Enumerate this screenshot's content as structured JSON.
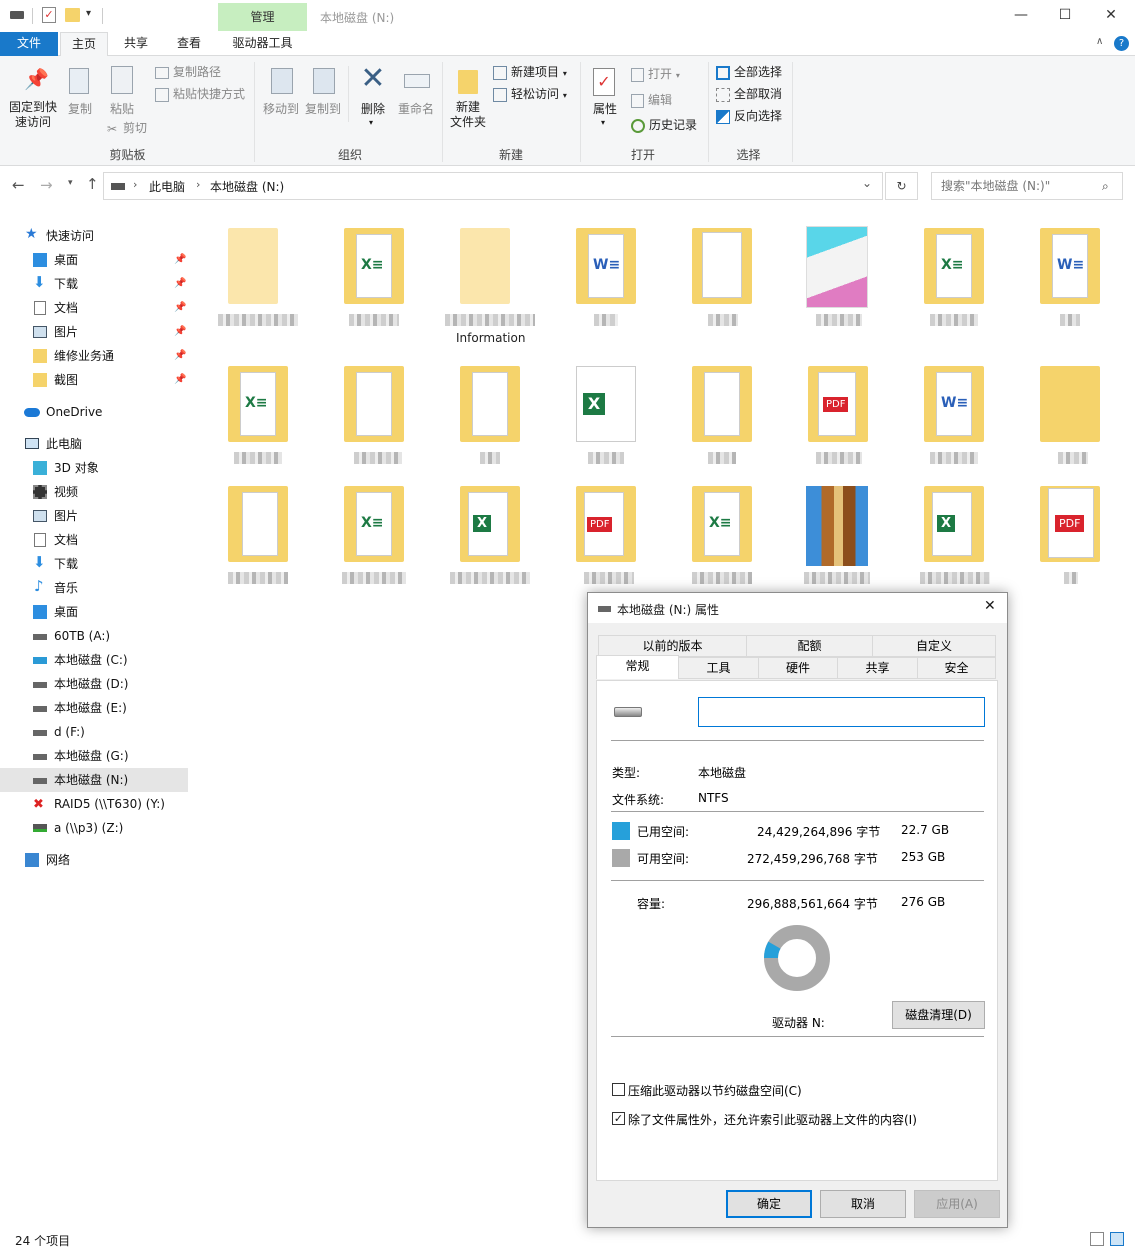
{
  "window": {
    "context_tab": "管理",
    "title": "本地磁盘 (N:)",
    "minimize": "—",
    "maximize": "☐",
    "close": "✕"
  },
  "ribbon_tabs": [
    {
      "label": "文件"
    },
    {
      "label": "主页"
    },
    {
      "label": "共享"
    },
    {
      "label": "查看"
    },
    {
      "label": "驱动器工具"
    }
  ],
  "ribbon": {
    "clipboard": {
      "pin": "固定到快\n速访问",
      "copy": "复制",
      "paste": "粘贴",
      "copy_path": "复制路径",
      "paste_shortcut": "粘贴快捷方式",
      "cut": "剪切",
      "label": "剪贴板"
    },
    "organize": {
      "move_to": "移动到",
      "copy_to": "复制到",
      "delete": "删除",
      "rename": "重命名",
      "label": "组织"
    },
    "new": {
      "new_folder": "新建\n文件夹",
      "new_item": "新建项目",
      "easy_access": "轻松访问",
      "label": "新建"
    },
    "open": {
      "properties": "属性",
      "open": "打开",
      "edit": "编辑",
      "history": "历史记录",
      "label": "打开"
    },
    "select": {
      "select_all": "全部选择",
      "select_none": "全部取消",
      "invert": "反向选择",
      "label": "选择"
    }
  },
  "address": {
    "crumb1": "此电脑",
    "crumb2": "本地磁盘 (N:)",
    "search_placeholder": "搜索\"本地磁盘 (N:)\""
  },
  "nav": {
    "quick_access": "快速访问",
    "quick_items": [
      {
        "label": "桌面"
      },
      {
        "label": "下载"
      },
      {
        "label": "文档"
      },
      {
        "label": "图片"
      },
      {
        "label": "维修业务通"
      },
      {
        "label": "截图"
      }
    ],
    "onedrive": "OneDrive",
    "this_pc": "此电脑",
    "pc_items": [
      {
        "label": "3D 对象"
      },
      {
        "label": "视频"
      },
      {
        "label": "图片"
      },
      {
        "label": "文档"
      },
      {
        "label": "下载"
      },
      {
        "label": "音乐"
      },
      {
        "label": "桌面"
      },
      {
        "label": "60TB (A:)"
      },
      {
        "label": "本地磁盘 (C:)"
      },
      {
        "label": "本地磁盘 (D:)"
      },
      {
        "label": "本地磁盘 (E:)"
      },
      {
        "label": "d (F:)"
      },
      {
        "label": "本地磁盘 (G:)"
      },
      {
        "label": "本地磁盘 (N:)"
      },
      {
        "label": "RAID5 (\\\\T630) (Y:)"
      },
      {
        "label": "a (\\\\p3) (Z:)"
      }
    ],
    "network": "网络"
  },
  "files": {
    "visible_label": "Information"
  },
  "status": {
    "count": "24 个项目"
  },
  "dialog": {
    "title": "本地磁盘 (N:) 属性",
    "tabs_row1": [
      {
        "label": "以前的版本"
      },
      {
        "label": "配额"
      },
      {
        "label": "自定义"
      }
    ],
    "tabs_row2": [
      {
        "label": "常规"
      },
      {
        "label": "工具"
      },
      {
        "label": "硬件"
      },
      {
        "label": "共享"
      },
      {
        "label": "安全"
      }
    ],
    "name_value": "",
    "type_label": "类型:",
    "type_value": "本地磁盘",
    "fs_label": "文件系统:",
    "fs_value": "NTFS",
    "used_label": "已用空间:",
    "used_bytes": "24,429,264,896 字节",
    "used_size": "22.7 GB",
    "free_label": "可用空间:",
    "free_bytes": "272,459,296,768 字节",
    "free_size": "253 GB",
    "cap_label": "容量:",
    "cap_bytes": "296,888,561,664 字节",
    "cap_size": "276 GB",
    "used_fraction": 0.0823,
    "drive_label": "驱动器 N:",
    "cleanup_button": "磁盘清理(D)",
    "compress_label": "压缩此驱动器以节约磁盘空间(C)",
    "compress_checked": false,
    "index_label": "除了文件属性外，还允许索引此驱动器上文件的内容(I)",
    "index_checked": true,
    "ok": "确定",
    "cancel": "取消",
    "apply": "应用(A)",
    "colors": {
      "used": "#26a0da",
      "free": "#a9a9a9"
    }
  }
}
